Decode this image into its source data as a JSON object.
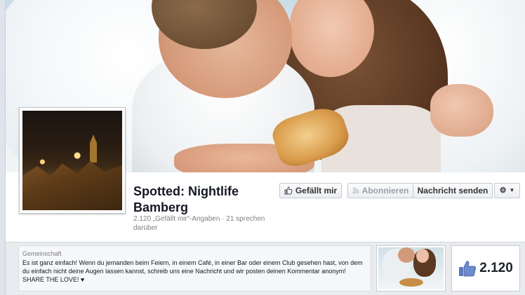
{
  "page": {
    "title": "Spotted: Nightlife Bamberg",
    "stats": "2.120 „Gefällt mir“-Angaben · 21 sprechen darüber"
  },
  "actions": {
    "like_label": "Gefällt mir",
    "subscribe_label": "Abonnieren",
    "message_label": "Nachricht senden",
    "gear_icon": "gear-icon"
  },
  "about": {
    "heading": "Gemeinschaft",
    "text": "Es ist ganz einfach! Wenn du jemanden beim Feiern, in einem Café, in einer Bar oder einem Club gesehen hast, von dem du einfach nicht deine Augen lassen kannst, schreib uns eine Nachricht und wir posten deinen Kommentar anonym! SHARE THE LOVE! ♥"
  },
  "likes": {
    "count": "2.120",
    "icon": "thumbs-up-icon"
  },
  "colors": {
    "accent": "#3b5998",
    "muted_text": "#7f7f7f",
    "border": "#c9ccd2"
  }
}
